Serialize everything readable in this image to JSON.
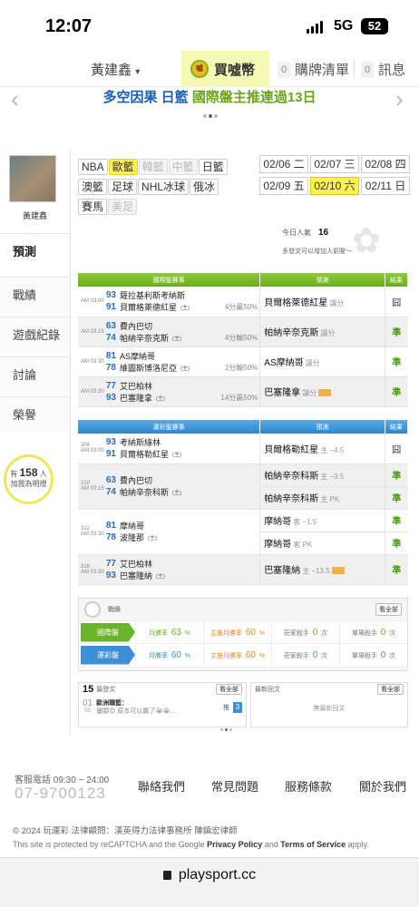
{
  "status": {
    "time": "12:07",
    "network": "5G",
    "battery": "52"
  },
  "topnav": {
    "user": "黃建鑫",
    "coin": "買噓幣",
    "coin_icon": "coin-icon",
    "cart_count": "0",
    "cart": "購牌清單",
    "msg_count": "0",
    "msg": "訊息"
  },
  "banner": {
    "part1": "多空因果",
    "part2": "日籃",
    "part3": "國際盤主推連過13日"
  },
  "profile": {
    "name": "黃建鑫"
  },
  "menu": [
    "預測",
    "戰績",
    "遊戲紀錄",
    "討論",
    "榮譽"
  ],
  "fans": {
    "pre": "有",
    "count": "158",
    "post": "人",
    "line2": "加我為明燈"
  },
  "leagues": [
    {
      "label": "NBA",
      "state": "normal"
    },
    {
      "label": "歐籃",
      "state": "active"
    },
    {
      "label": "韓籃",
      "state": "disabled"
    },
    {
      "label": "中籃",
      "state": "disabled"
    },
    {
      "label": "日籃",
      "state": "normal"
    },
    {
      "label": "澳籃",
      "state": "normal"
    },
    {
      "label": "足球",
      "state": "normal"
    },
    {
      "label": "NHL冰球",
      "state": "normal"
    },
    {
      "label": "俄冰",
      "state": "normal"
    },
    {
      "label": "賽馬",
      "state": "normal"
    },
    {
      "label": "美足",
      "state": "disabled"
    }
  ],
  "dates": [
    {
      "label": "02/06 二",
      "active": false
    },
    {
      "label": "02/07 三",
      "active": false
    },
    {
      "label": "02/08 四",
      "active": false
    },
    {
      "label": "02/09 五",
      "active": false
    },
    {
      "label": "02/10 六",
      "active": true
    },
    {
      "label": "02/11 日",
      "active": false
    }
  ],
  "popularity": {
    "label": "今日人氣",
    "value": "16",
    "hint": "多發文可以增加人氣喔～"
  },
  "intl": {
    "headers": [
      "國際盤賽事",
      "預測",
      "結果"
    ],
    "rows": [
      {
        "time": "AM 03:00",
        "n1": "93",
        "t1": "薩拉基利斯考納斯",
        "n2": "91",
        "t2": "貝爾格萊德紅星",
        "home": "(主)",
        "hc": "4分贏50%",
        "pick": "貝爾格萊德紅星",
        "pick_note": "讓分",
        "hot": false,
        "result": "囧",
        "win": false
      },
      {
        "time": "AM 03:15",
        "n1": "63",
        "t1": "費內巴切",
        "n2": "74",
        "t2": "帕納辛奈克斯",
        "home": "(主)",
        "hc": "4分輸50%",
        "pick": "帕納辛奈克斯",
        "pick_note": "讓分",
        "hot": false,
        "result": "準",
        "win": true
      },
      {
        "time": "AM 03:30",
        "n1": "81",
        "t1": "AS摩納哥",
        "n2": "78",
        "t2": "維圖斯博洛尼亞",
        "home": "(主)",
        "hc": "1分輸50%",
        "pick": "AS摩納哥",
        "pick_note": "讓分",
        "hot": false,
        "result": "準",
        "win": true
      },
      {
        "time": "AM 03:30",
        "n1": "77",
        "t1": "艾巴柏林",
        "n2": "93",
        "t2": "巴塞隆拿",
        "home": "(主)",
        "hc": "14分贏50%",
        "pick": "巴塞隆拿",
        "pick_note": "讓分",
        "hot": true,
        "result": "準",
        "win": true
      }
    ]
  },
  "lottery": {
    "headers": [
      "運彩盤賽事",
      "預測",
      "結果"
    ],
    "rows": [
      {
        "no": "304",
        "time": "AM 03:00",
        "n1": "93",
        "t1": "考納斯綠林",
        "n2": "91",
        "t2": "貝爾格勒紅星",
        "home": "(主)",
        "picks": [
          {
            "pick": "貝爾格勒紅星",
            "note": "主 −4.5",
            "hot": false,
            "result": "囧",
            "win": false
          }
        ]
      },
      {
        "no": "310",
        "time": "AM 03:15",
        "n1": "63",
        "t1": "費內巴切",
        "n2": "74",
        "t2": "帕納辛奈科斯",
        "home": "(主)",
        "picks": [
          {
            "pick": "帕納辛奈科斯",
            "note": "主 −3.5",
            "hot": false,
            "result": "準",
            "win": true
          },
          {
            "pick": "帕納辛奈科斯",
            "note": "主 PK",
            "hot": false,
            "result": "準",
            "win": true
          }
        ]
      },
      {
        "no": "312",
        "time": "AM 03:30",
        "n1": "81",
        "t1": "摩納哥",
        "n2": "78",
        "t2": "波隆那",
        "home": "(主)",
        "picks": [
          {
            "pick": "摩納哥",
            "note": "客 −1.5",
            "hot": false,
            "result": "準",
            "win": true
          },
          {
            "pick": "摩納哥",
            "note": "客 PK",
            "hot": false,
            "result": "準",
            "win": true
          }
        ]
      },
      {
        "no": "316",
        "time": "AM 03:30",
        "n1": "77",
        "t1": "艾巴柏林",
        "n2": "93",
        "t2": "巴塞隆納",
        "home": "(主)",
        "picks": [
          {
            "pick": "巴塞隆納",
            "note": "主 −13.5",
            "hot": true,
            "result": "準",
            "win": true
          }
        ]
      }
    ]
  },
  "record": {
    "title": "戰績",
    "more": "看全部",
    "rows": [
      {
        "label": "國際盤",
        "c1": "月勝率",
        "v1": "63",
        "c2": "主推月勝率",
        "v2": "60",
        "c3": "莊家殺手",
        "v3": "0",
        "c4": "單場殺手",
        "v4": "0",
        "pct": "%",
        "unit": "次"
      },
      {
        "label": "運彩盤",
        "c1": "月勝率",
        "v1": "60",
        "c2": "主推月勝率",
        "v2": "60",
        "c3": "莊家殺手",
        "v3": "0",
        "c4": "單場殺手",
        "v4": "0",
        "pct": "%",
        "unit": "次"
      }
    ]
  },
  "posts": {
    "count": "15",
    "label": "篇發文",
    "more": "看全部",
    "day": "01",
    "month": "02",
    "title": "歐洲職籃：",
    "preview": "優顆😊 原本可以贏了😭😭...",
    "push": "推",
    "push_count": "3"
  },
  "replies": {
    "label": "最新回文",
    "more": "看全部",
    "empty": "無最新回文"
  },
  "footer": {
    "service": "客服電話 09:30 ~ 24:00",
    "phone": "07-9700123",
    "links": [
      "聯絡我們",
      "常見問題",
      "服務條款",
      "關於我們"
    ],
    "copyright": "© 2024 玩運彩 法律顧問：漢英得力法律事務所 陳鎮宏律師",
    "recaptcha_a": "This site is protected by reCAPTCHA and the Google",
    "privacy": "Privacy Policy",
    "and": "and",
    "terms": "Terms of Service",
    "apply": "apply."
  },
  "url": "playsport.cc"
}
